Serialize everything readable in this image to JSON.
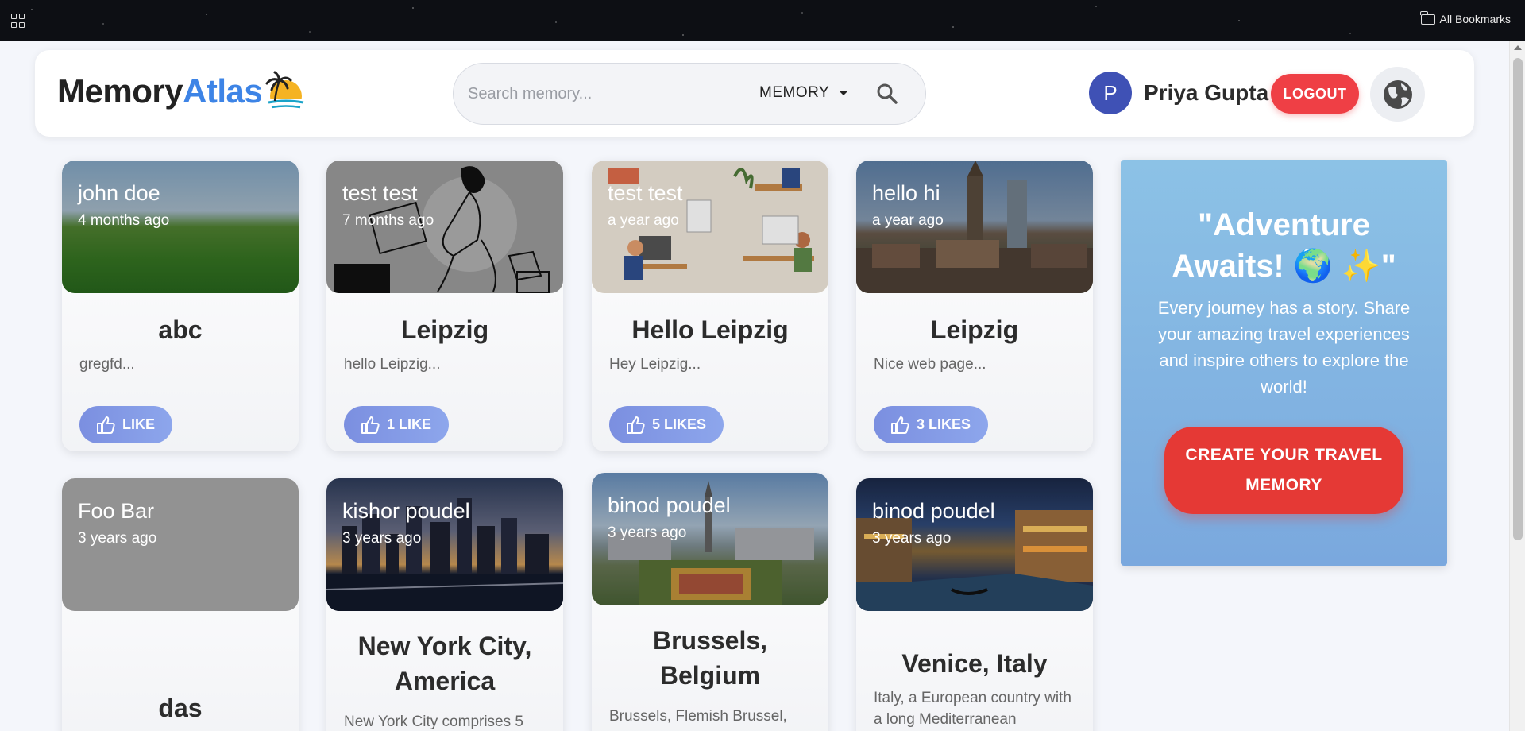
{
  "browser": {
    "all_bookmarks": "All Bookmarks"
  },
  "header": {
    "logo_part1": "Memory",
    "logo_part2": "Atlas",
    "search_placeholder": "Search memory...",
    "search_type": "MEMORY",
    "user_initial": "P",
    "user_name": "Priya Gupta",
    "logout_label": "LOGOUT"
  },
  "cards": [
    {
      "author": "john doe",
      "time": "4 months ago",
      "title": "abc",
      "desc": "gregfd...",
      "likes": "LIKE"
    },
    {
      "author": "test test",
      "time": "7 months ago",
      "title": "Leipzig",
      "desc": "hello Leipzig...",
      "likes": "1 LIKE"
    },
    {
      "author": "test test",
      "time": "a year ago",
      "title": "Hello Leipzig",
      "desc": "Hey Leipzig...",
      "likes": "5 LIKES"
    },
    {
      "author": "hello hi",
      "time": "a year ago",
      "title": "Leipzig",
      "desc": "Nice web page...",
      "likes": "3 LIKES"
    },
    {
      "author": "Foo Bar",
      "time": "3 years ago",
      "title": "das",
      "desc": ""
    },
    {
      "author": "kishor poudel",
      "time": "3 years ago",
      "title": "New York City, America",
      "desc": "New York City comprises 5"
    },
    {
      "author": "binod poudel",
      "time": "3 years ago",
      "title": "Brussels, Belgium",
      "desc": "Brussels, Flemish Brussel, French Bruxelles, city, capital"
    },
    {
      "author": "binod poudel",
      "time": "3 years ago",
      "title": "Venice, Italy",
      "desc": "Italy, a European country with a long Mediterranean"
    }
  ],
  "promo": {
    "title": "\"Adventure Awaits! 🌍 ✨\"",
    "text": "Every journey has a story. Share your amazing travel experiences and inspire others to explore the world!",
    "button": "CREATE YOUR TRAVEL MEMORY"
  }
}
